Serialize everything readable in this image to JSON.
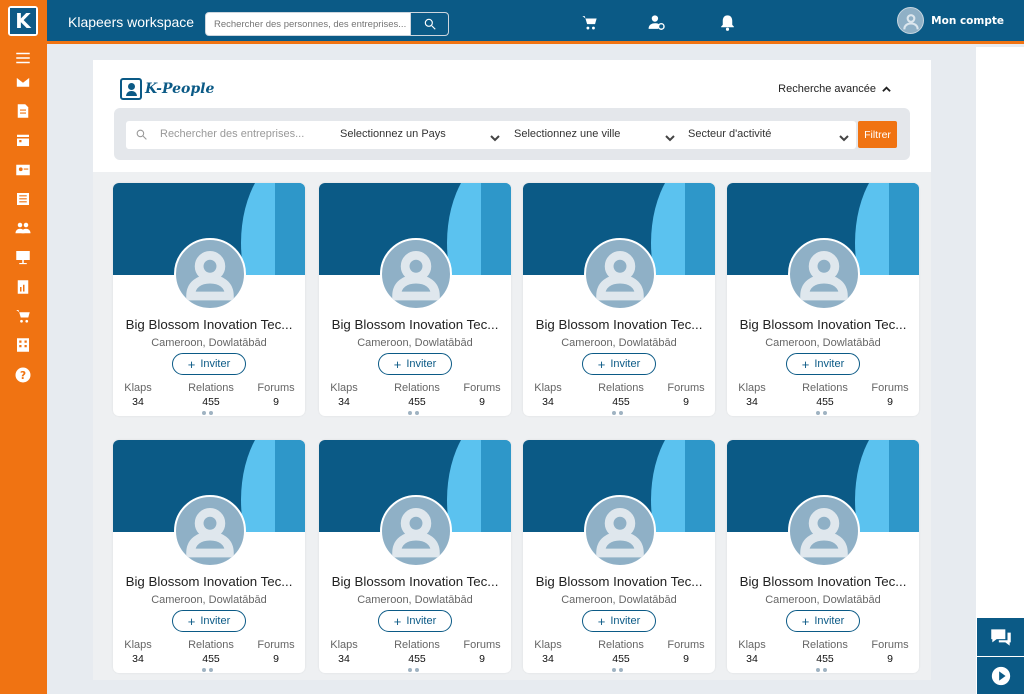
{
  "app": {
    "brand": "Klapeers workspace",
    "logo_letter": "K",
    "search_placeholder": "Rechercher des personnes, des entreprises...",
    "account_label": "Mon compte",
    "accent_color": "#f07312",
    "primary_color": "#0b5a86"
  },
  "sidebar": {
    "icons": [
      "menu-icon",
      "mail-icon",
      "document-icon",
      "calendar-icon",
      "contact-card-icon",
      "book-icon",
      "group-icon",
      "presentation-icon",
      "report-icon",
      "cart-icon",
      "building-icon",
      "help-icon"
    ]
  },
  "topbar": {
    "icons": [
      "cart-icon",
      "user-settings-icon",
      "bell-icon"
    ]
  },
  "kpeople": {
    "title": "K-People",
    "advanced_search": "Recherche avancée"
  },
  "filters": {
    "search_placeholder": "Rechercher des entreprises...",
    "country": "Selectionnez un Pays",
    "city": "Selectionnez une ville",
    "sector": "Secteur d'activité",
    "filter_button": "Filtrer"
  },
  "cards": [
    {
      "name": "Big Blossom Inovation Tec...",
      "location": "Cameroon, Dowlatābād",
      "invite": "Inviter",
      "klaps_label": "Klaps",
      "klaps": "34",
      "relations_label": "Relations",
      "relations": "455",
      "forums_label": "Forums",
      "forums": "9"
    },
    {
      "name": "Big Blossom Inovation Tec...",
      "location": "Cameroon, Dowlatābād",
      "invite": "Inviter",
      "klaps_label": "Klaps",
      "klaps": "34",
      "relations_label": "Relations",
      "relations": "455",
      "forums_label": "Forums",
      "forums": "9"
    },
    {
      "name": "Big Blossom Inovation Tec...",
      "location": "Cameroon, Dowlatābād",
      "invite": "Inviter",
      "klaps_label": "Klaps",
      "klaps": "34",
      "relations_label": "Relations",
      "relations": "455",
      "forums_label": "Forums",
      "forums": "9"
    },
    {
      "name": "Big Blossom Inovation Tec...",
      "location": "Cameroon, Dowlatābād",
      "invite": "Inviter",
      "klaps_label": "Klaps",
      "klaps": "34",
      "relations_label": "Relations",
      "relations": "455",
      "forums_label": "Forums",
      "forums": "9"
    },
    {
      "name": "Big Blossom Inovation Tec...",
      "location": "Cameroon, Dowlatābād",
      "invite": "Inviter",
      "klaps_label": "Klaps",
      "klaps": "34",
      "relations_label": "Relations",
      "relations": "455",
      "forums_label": "Forums",
      "forums": "9"
    },
    {
      "name": "Big Blossom Inovation Tec...",
      "location": "Cameroon, Dowlatābād",
      "invite": "Inviter",
      "klaps_label": "Klaps",
      "klaps": "34",
      "relations_label": "Relations",
      "relations": "455",
      "forums_label": "Forums",
      "forums": "9"
    },
    {
      "name": "Big Blossom Inovation Tec...",
      "location": "Cameroon, Dowlatābād",
      "invite": "Inviter",
      "klaps_label": "Klaps",
      "klaps": "34",
      "relations_label": "Relations",
      "relations": "455",
      "forums_label": "Forums",
      "forums": "9"
    },
    {
      "name": "Big Blossom Inovation Tec...",
      "location": "Cameroon, Dowlatābād",
      "invite": "Inviter",
      "klaps_label": "Klaps",
      "klaps": "34",
      "relations_label": "Relations",
      "relations": "455",
      "forums_label": "Forums",
      "forums": "9"
    }
  ],
  "floating": {
    "icons": [
      "chat-icon",
      "play-icon"
    ]
  }
}
